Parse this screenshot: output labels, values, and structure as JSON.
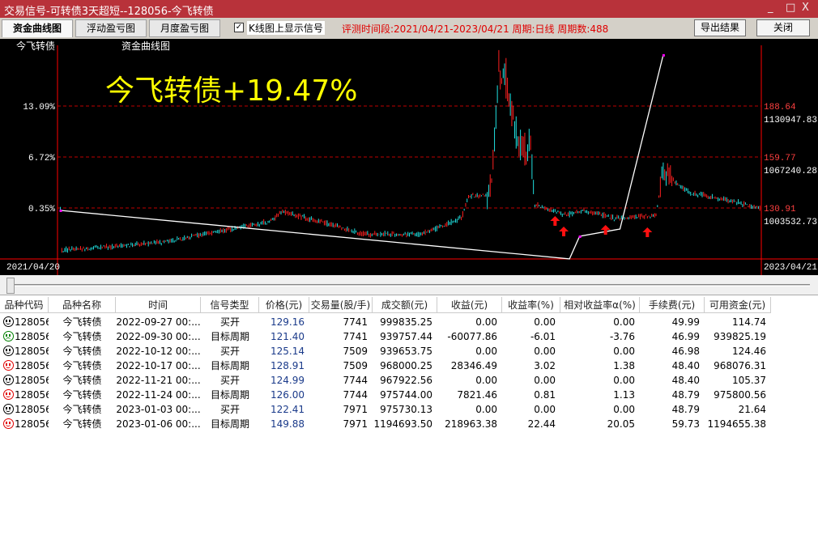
{
  "window": {
    "title": "交易信号-可转债3天超短--128056-今飞转债",
    "controls": [
      "_",
      "□",
      "X"
    ]
  },
  "toolbar": {
    "tabs": [
      "资金曲线图",
      "浮动盈亏图",
      "月度盈亏图"
    ],
    "active_tab": 0,
    "checkbox_label": "K线图上显示信号",
    "checkbox_checked": true,
    "info": "评测时间段:2021/04/21-2023/04/21  周期:日线  周期数:488",
    "export_label": "导出结果",
    "close_label": "关闭"
  },
  "chart": {
    "name_label": "今飞转债",
    "chart_label": "资金曲线图",
    "headline": "今飞转债+19.47%",
    "left_axis": [
      "13.09%",
      "6.72%",
      "0.35%"
    ],
    "right_price": [
      "188.64",
      "159.77",
      "130.91"
    ],
    "right_equity": [
      "1130947.83",
      "1067240.28",
      "1003532.73"
    ],
    "start_date": "2021/04/20",
    "end_date": "2023/04/21",
    "colors": {
      "up": "#ff2020",
      "down": "#20e0e0",
      "equity": "#ffffff",
      "grid": "#c00000",
      "headline": "#ffff00"
    },
    "equity_curve": [
      {
        "bar": 2,
        "pct": 0.05
      },
      {
        "bar": 355,
        "pct": -6.01
      },
      {
        "bar": 362,
        "pct": -3.19
      },
      {
        "bar": 390,
        "pct": -2.28
      },
      {
        "bar": 420,
        "pct": 19.47
      }
    ],
    "signal_bars": [
      345,
      351,
      380,
      409
    ]
  },
  "table": {
    "columns": [
      "品种代码",
      "品种名称",
      "时间",
      "信号类型",
      "价格(元)",
      "交易量(股/手)",
      "成交额(元)",
      "收益(元)",
      "收益率(%)",
      "相对收益率α(%)",
      "手续费(元)",
      "可用资金(元)"
    ],
    "rows": [
      {
        "face": "neutral",
        "code": "128056",
        "name": "今飞转债",
        "time": "2022-09-27 00:...",
        "type": "买开",
        "price": "129.16",
        "vol": "7741",
        "amount": "999835.25",
        "profit": "0.00",
        "rate": "0.00",
        "alpha": "0.00",
        "fee": "49.99",
        "cash": "114.74"
      },
      {
        "face": "loss",
        "code": "128056",
        "name": "今飞转债",
        "time": "2022-09-30 00:...",
        "type": "目标周期",
        "price": "121.40",
        "vol": "7741",
        "amount": "939757.44",
        "profit": "-60077.86",
        "rate": "-6.01",
        "alpha": "-3.76",
        "fee": "46.99",
        "cash": "939825.19"
      },
      {
        "face": "neutral",
        "code": "128056",
        "name": "今飞转债",
        "time": "2022-10-12 00:...",
        "type": "买开",
        "price": "125.14",
        "vol": "7509",
        "amount": "939653.75",
        "profit": "0.00",
        "rate": "0.00",
        "alpha": "0.00",
        "fee": "46.98",
        "cash": "124.46"
      },
      {
        "face": "win",
        "code": "128056",
        "name": "今飞转债",
        "time": "2022-10-17 00:...",
        "type": "目标周期",
        "price": "128.91",
        "vol": "7509",
        "amount": "968000.25",
        "profit": "28346.49",
        "rate": "3.02",
        "alpha": "1.38",
        "fee": "48.40",
        "cash": "968076.31"
      },
      {
        "face": "neutral",
        "code": "128056",
        "name": "今飞转债",
        "time": "2022-11-21 00:...",
        "type": "买开",
        "price": "124.99",
        "vol": "7744",
        "amount": "967922.56",
        "profit": "0.00",
        "rate": "0.00",
        "alpha": "0.00",
        "fee": "48.40",
        "cash": "105.37"
      },
      {
        "face": "win",
        "code": "128056",
        "name": "今飞转债",
        "time": "2022-11-24 00:...",
        "type": "目标周期",
        "price": "126.00",
        "vol": "7744",
        "amount": "975744.00",
        "profit": "7821.46",
        "rate": "0.81",
        "alpha": "1.13",
        "fee": "48.79",
        "cash": "975800.56"
      },
      {
        "face": "neutral",
        "code": "128056",
        "name": "今飞转债",
        "time": "2023-01-03 00:...",
        "type": "买开",
        "price": "122.41",
        "vol": "7971",
        "amount": "975730.13",
        "profit": "0.00",
        "rate": "0.00",
        "alpha": "0.00",
        "fee": "48.79",
        "cash": "21.64"
      },
      {
        "face": "win",
        "code": "128056",
        "name": "今飞转债",
        "time": "2023-01-06 00:...",
        "type": "目标周期",
        "price": "149.88",
        "vol": "7971",
        "amount": "1194693.50",
        "profit": "218963.38",
        "rate": "22.44",
        "alpha": "20.05",
        "fee": "59.73",
        "cash": "1194655.38"
      }
    ]
  }
}
